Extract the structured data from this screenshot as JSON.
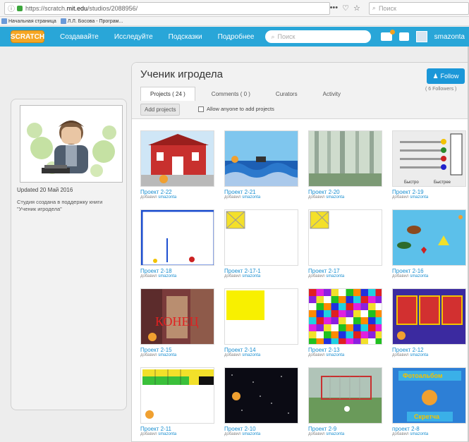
{
  "browser": {
    "url_prefix": "https://scratch.",
    "url_domain": "mit.edu",
    "url_suffix": "/studios/2088956/",
    "menu_dots": "•••",
    "search_placeholder": "Поиск",
    "bookmarks": [
      "Начальная страница",
      "Л.Л. Босова - Програм..."
    ]
  },
  "nav": {
    "logo": "SCRATCH",
    "links": [
      "Создавайте",
      "Исследуйте",
      "Подсказки",
      "Подробнее"
    ],
    "search_placeholder": "Поиск",
    "username": "smazonta"
  },
  "sidebar": {
    "updated": "Updated 20 Май 2016",
    "description": "Студия создана в поддержку книги \"Ученик игродела\""
  },
  "studio": {
    "title": "Ученик игродела",
    "follow_label": "Follow",
    "followers": "( 6 Followers )",
    "tabs": [
      "Projects ( 24 )",
      "Comments ( 0 )",
      "Curators",
      "Activity"
    ],
    "add_projects": "Add projects",
    "allow_label": "Allow anyone to add projects"
  },
  "projects": [
    {
      "title": "Проект 2-22",
      "added_by": "добавил",
      "author": "smazonta"
    },
    {
      "title": "Проект 2-21",
      "added_by": "добавил",
      "author": "smazonta"
    },
    {
      "title": "Проект 2-20",
      "added_by": "добавил",
      "author": "smazonta"
    },
    {
      "title": "Проект 2-19",
      "added_by": "добавил",
      "author": "smazonta"
    },
    {
      "title": "Проект 2-18",
      "added_by": "добавил",
      "author": "smazonta"
    },
    {
      "title": "Проект 2-17-1",
      "added_by": "добавил",
      "author": "smazonta"
    },
    {
      "title": "Проект 2-17",
      "added_by": "добавил",
      "author": "smazonta"
    },
    {
      "title": "Проект 2-16",
      "added_by": "добавил",
      "author": "smazonta"
    },
    {
      "title": "Проект 2-15",
      "added_by": "добавил",
      "author": "smazonta"
    },
    {
      "title": "Проект 2-14",
      "added_by": "добавил",
      "author": "smazonta"
    },
    {
      "title": "Проект 2-13",
      "added_by": "добавил",
      "author": "smazonta"
    },
    {
      "title": "Проект 2-12",
      "added_by": "добавил",
      "author": "smazonta"
    },
    {
      "title": "Проект 2-11",
      "added_by": "добавил",
      "author": "smazonta"
    },
    {
      "title": "Проект 2-10",
      "added_by": "добавил",
      "author": "smazonta"
    },
    {
      "title": "Проект 2-9",
      "added_by": "добавил",
      "author": "smazonta"
    },
    {
      "title": "проект 2-8",
      "added_by": "добавил",
      "author": "smazonta"
    }
  ],
  "thumb_text": {
    "p21_end": "КОНЕЦ",
    "p8_top": "Фотоальбом",
    "p8_bottom": "Скретча",
    "p19_left": "Быстро",
    "p19_right": "Быстрее"
  },
  "colors": {
    "accent": "#29a6d8",
    "link": "#1b8fd0",
    "follow": "#1b97d8"
  }
}
